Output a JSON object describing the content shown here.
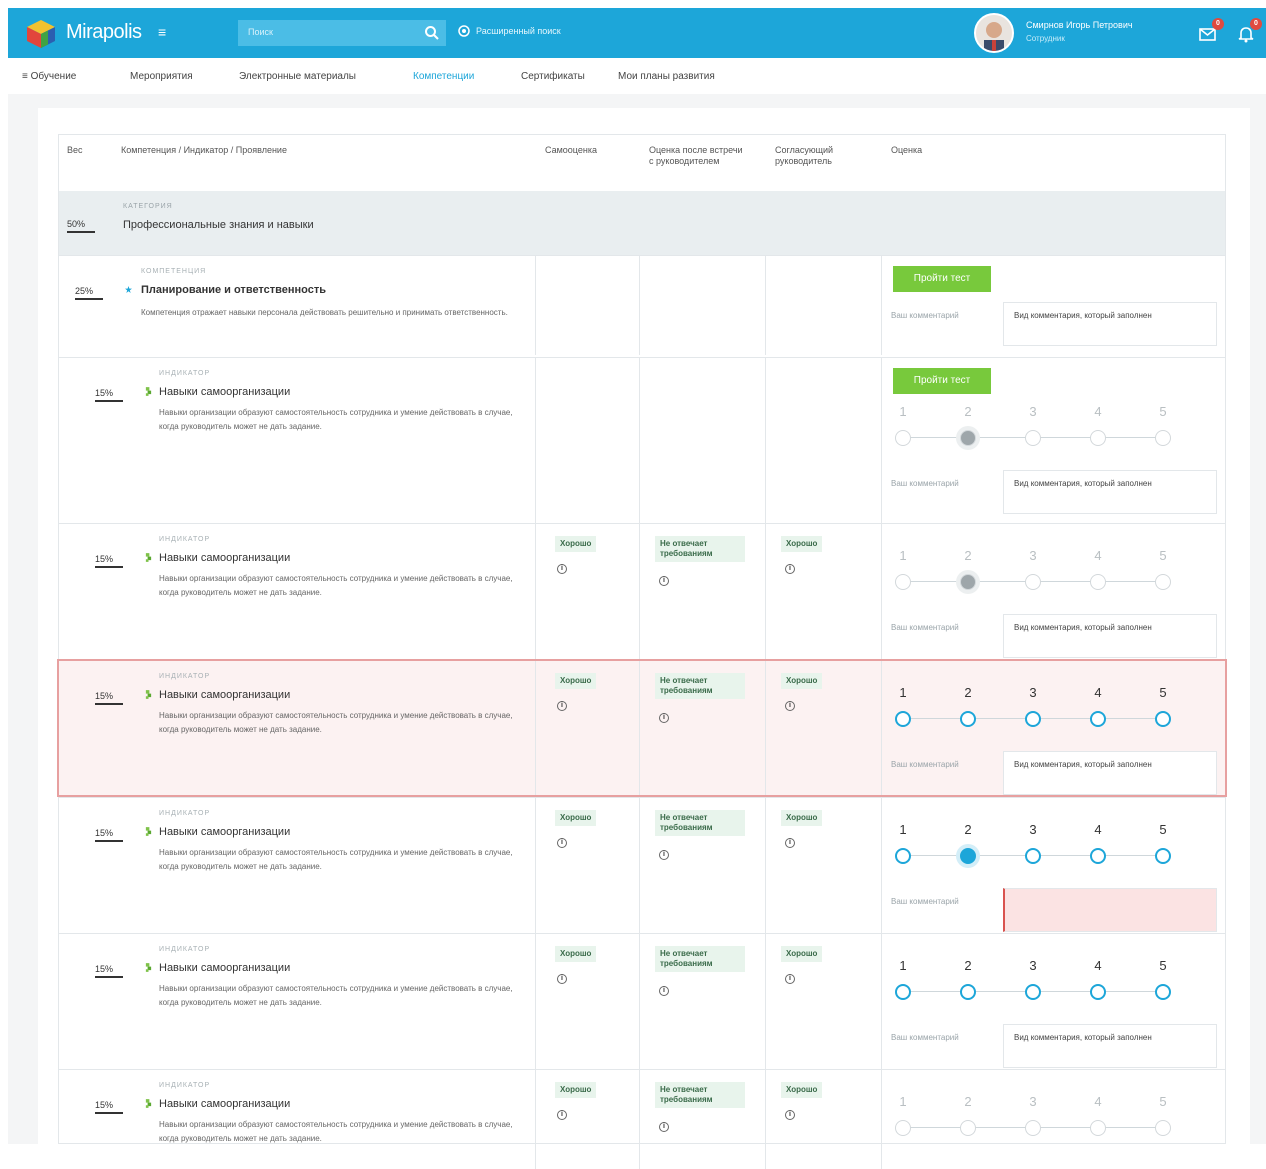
{
  "app": {
    "name": "Mirapolis"
  },
  "search": {
    "placeholder": "Поиск",
    "advanced": "Расширенный поиск"
  },
  "user": {
    "name": "Смирнов Игорь Петрович",
    "role": "Сотрудник",
    "mail_badge": "0",
    "bell_badge": "0"
  },
  "nav": {
    "menu_label": "Обучение",
    "items": [
      "Мероприятия",
      "Электронные материалы",
      "Компетенции",
      "Сертификаты",
      "Мои планы развития"
    ],
    "active_index": 2
  },
  "table": {
    "headers": {
      "weight": "Вес",
      "competency": "Компетенция / Индикатор / Проявление",
      "self": "Самооценка",
      "after_meeting": "Оценка после встречи с руководителем",
      "approver": "Согласующий руководитель",
      "rating": "Оценка"
    },
    "category": {
      "kind": "КАТЕГОРИЯ",
      "weight": "50%",
      "title": "Профессиональные знания и навыки"
    },
    "competency": {
      "kind": "КОМПЕТЕНЦИЯ",
      "weight": "25%",
      "title": "Планирование и ответственность",
      "desc": "Компетенция отражает навыки персонала действовать решительно и принимать ответственность.",
      "button": "Пройти тест",
      "comment_label": "Ваш комментарий",
      "comment_value": "Вид комментария, который заполнен"
    },
    "indicators": [
      {
        "kind": "ИНДИКАТОР",
        "weight": "15%",
        "title": "Навыки самоорганизации",
        "desc": "Навыки организации образуют самостоятельность сотрудника и умение действовать в случае, когда руководитель может не дать задание.",
        "self": "",
        "after": "",
        "approver": "",
        "button": "Пройти тест",
        "scale": [
          "1",
          "2",
          "3",
          "4",
          "5"
        ],
        "selected": 2,
        "state": "dim",
        "comment_label": "Ваш комментарий",
        "comment_value": "Вид комментария, который заполнен"
      },
      {
        "kind": "ИНДИКАТОР",
        "weight": "15%",
        "title": "Навыки самоорганизации",
        "desc": "Навыки организации образуют самостоятельность сотрудника и умение действовать в случае, когда руководитель может не дать задание.",
        "self": "Хорошо",
        "after": "Не отвечает требованиям",
        "approver": "Хорошо",
        "scale": [
          "1",
          "2",
          "3",
          "4",
          "5"
        ],
        "selected": 2,
        "state": "dim",
        "comment_label": "Ваш комментарий",
        "comment_value": "Вид комментария, который заполнен"
      },
      {
        "kind": "ИНДИКАТОР",
        "weight": "15%",
        "title": "Навыки самоорганизации",
        "desc": "Навыки организации образуют самостоятельность сотрудника и умение действовать в случае, когда руководитель может не дать задание.",
        "self": "Хорошо",
        "after": "Не отвечает требованиям",
        "approver": "Хорошо",
        "scale": [
          "1",
          "2",
          "3",
          "4",
          "5"
        ],
        "selected": 0,
        "state": "error",
        "comment_label": "Ваш комментарий",
        "comment_value": "Вид комментария, который заполнен"
      },
      {
        "kind": "ИНДИКАТОР",
        "weight": "15%",
        "title": "Навыки самоорганизации",
        "desc": "Навыки организации образуют самостоятельность сотрудника и умение действовать в случае, когда руководитель может не дать задание.",
        "self": "Хорошо",
        "after": "Не отвечает требованиям",
        "approver": "Хорошо",
        "scale": [
          "1",
          "2",
          "3",
          "4",
          "5"
        ],
        "selected": 2,
        "state": "active",
        "comment_label": "Ваш комментарий",
        "comment_value": "",
        "comment_error": true
      },
      {
        "kind": "ИНДИКАТОР",
        "weight": "15%",
        "title": "Навыки самоорганизации",
        "desc": "Навыки организации образуют самостоятельность сотрудника и умение действовать в случае, когда руководитель может не дать задание.",
        "self": "Хорошо",
        "after": "Не отвечает требованиям",
        "approver": "Хорошо",
        "scale": [
          "1",
          "2",
          "3",
          "4",
          "5"
        ],
        "selected": 0,
        "state": "active",
        "comment_label": "Ваш комментарий",
        "comment_value": "Вид комментария, который заполнен"
      },
      {
        "kind": "ИНДИКАТОР",
        "weight": "15%",
        "title": "Навыки самоорганизации",
        "desc": "Навыки организации образуют самостоятельность сотрудника и умение действовать в случае, когда руководитель может не дать задание.",
        "self": "Хорошо",
        "after": "Не отвечает требованиям",
        "approver": "Хорошо",
        "scale": [
          "1",
          "2",
          "3",
          "4",
          "5"
        ],
        "selected": 0,
        "state": "dim",
        "comment_label": "",
        "comment_value": ""
      }
    ]
  },
  "colors": {
    "brand": "#1da6d9",
    "green": "#78c93c",
    "error": "#e7a0a0"
  }
}
